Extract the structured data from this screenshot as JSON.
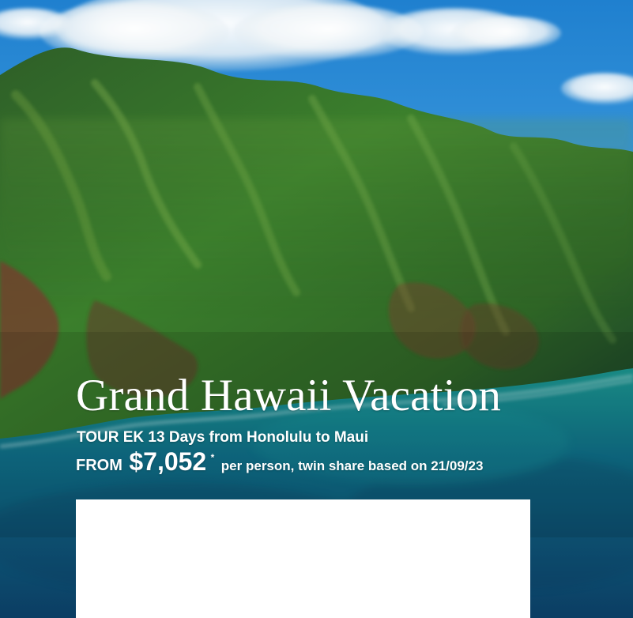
{
  "hero": {
    "title": "Grand Hawaii Vacation",
    "tourline": "TOUR EK 13 Days from Honolulu to Maui",
    "price": {
      "from_label": "FROM",
      "amount": "$7,052",
      "asterisk": "*",
      "suffix": "per person, twin share based on 21/09/23"
    }
  },
  "colors": {
    "sky_top": "#1f7fcf",
    "mountain_green": "#2d6a33",
    "ocean_teal": "#0e6e77",
    "text": "#ffffff",
    "panel": "#ffffff"
  }
}
